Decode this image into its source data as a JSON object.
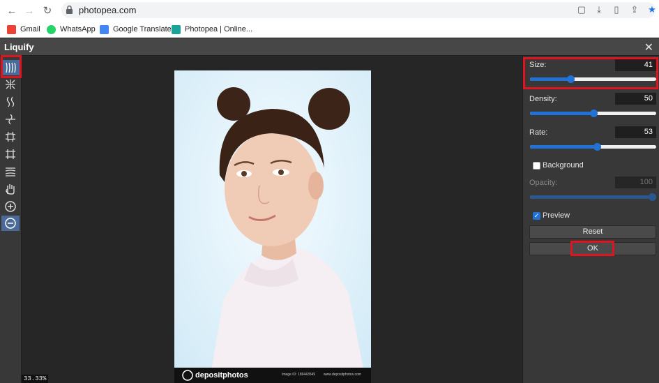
{
  "browser": {
    "url": "photopea.com",
    "bookmarks": [
      {
        "label": "Gmail",
        "icon": "gmail-icon",
        "color": "#ea4335"
      },
      {
        "label": "WhatsApp",
        "icon": "whatsapp-icon",
        "color": "#25d366"
      },
      {
        "label": "Google Translate",
        "icon": "translate-icon",
        "color": "#4285f4"
      },
      {
        "label": "Photopea | Online...",
        "icon": "photopea-icon",
        "color": "#18a497"
      }
    ]
  },
  "dialog": {
    "title": "Liquify",
    "tools": [
      "forward-warp-icon",
      "pucker-icon",
      "twirl-icon",
      "twirl-counter-icon",
      "bloat-icon",
      "push-left-icon",
      "reconstruct-icon",
      "hand-icon",
      "zoom-in-icon",
      "zoom-out-icon"
    ],
    "zoom_level": "33.33%",
    "watermark": {
      "brand": "depositphotos",
      "image_id": "Image ID: 189443549",
      "site": "www.depositphotos.com"
    }
  },
  "panel": {
    "size": {
      "label": "Size:",
      "value": "41",
      "fraction": 0.32
    },
    "density": {
      "label": "Density:",
      "value": "50",
      "fraction": 0.5
    },
    "rate": {
      "label": "Rate:",
      "value": "53",
      "fraction": 0.53
    },
    "background": {
      "label": "Background",
      "checked": false
    },
    "opacity": {
      "label": "Opacity:",
      "value": "100",
      "fraction": 1.0
    },
    "preview": {
      "label": "Preview",
      "checked": true
    },
    "reset_label": "Reset",
    "ok_label": "OK"
  },
  "colors": {
    "accent": "#2272d6",
    "highlight": "#e0141e"
  }
}
